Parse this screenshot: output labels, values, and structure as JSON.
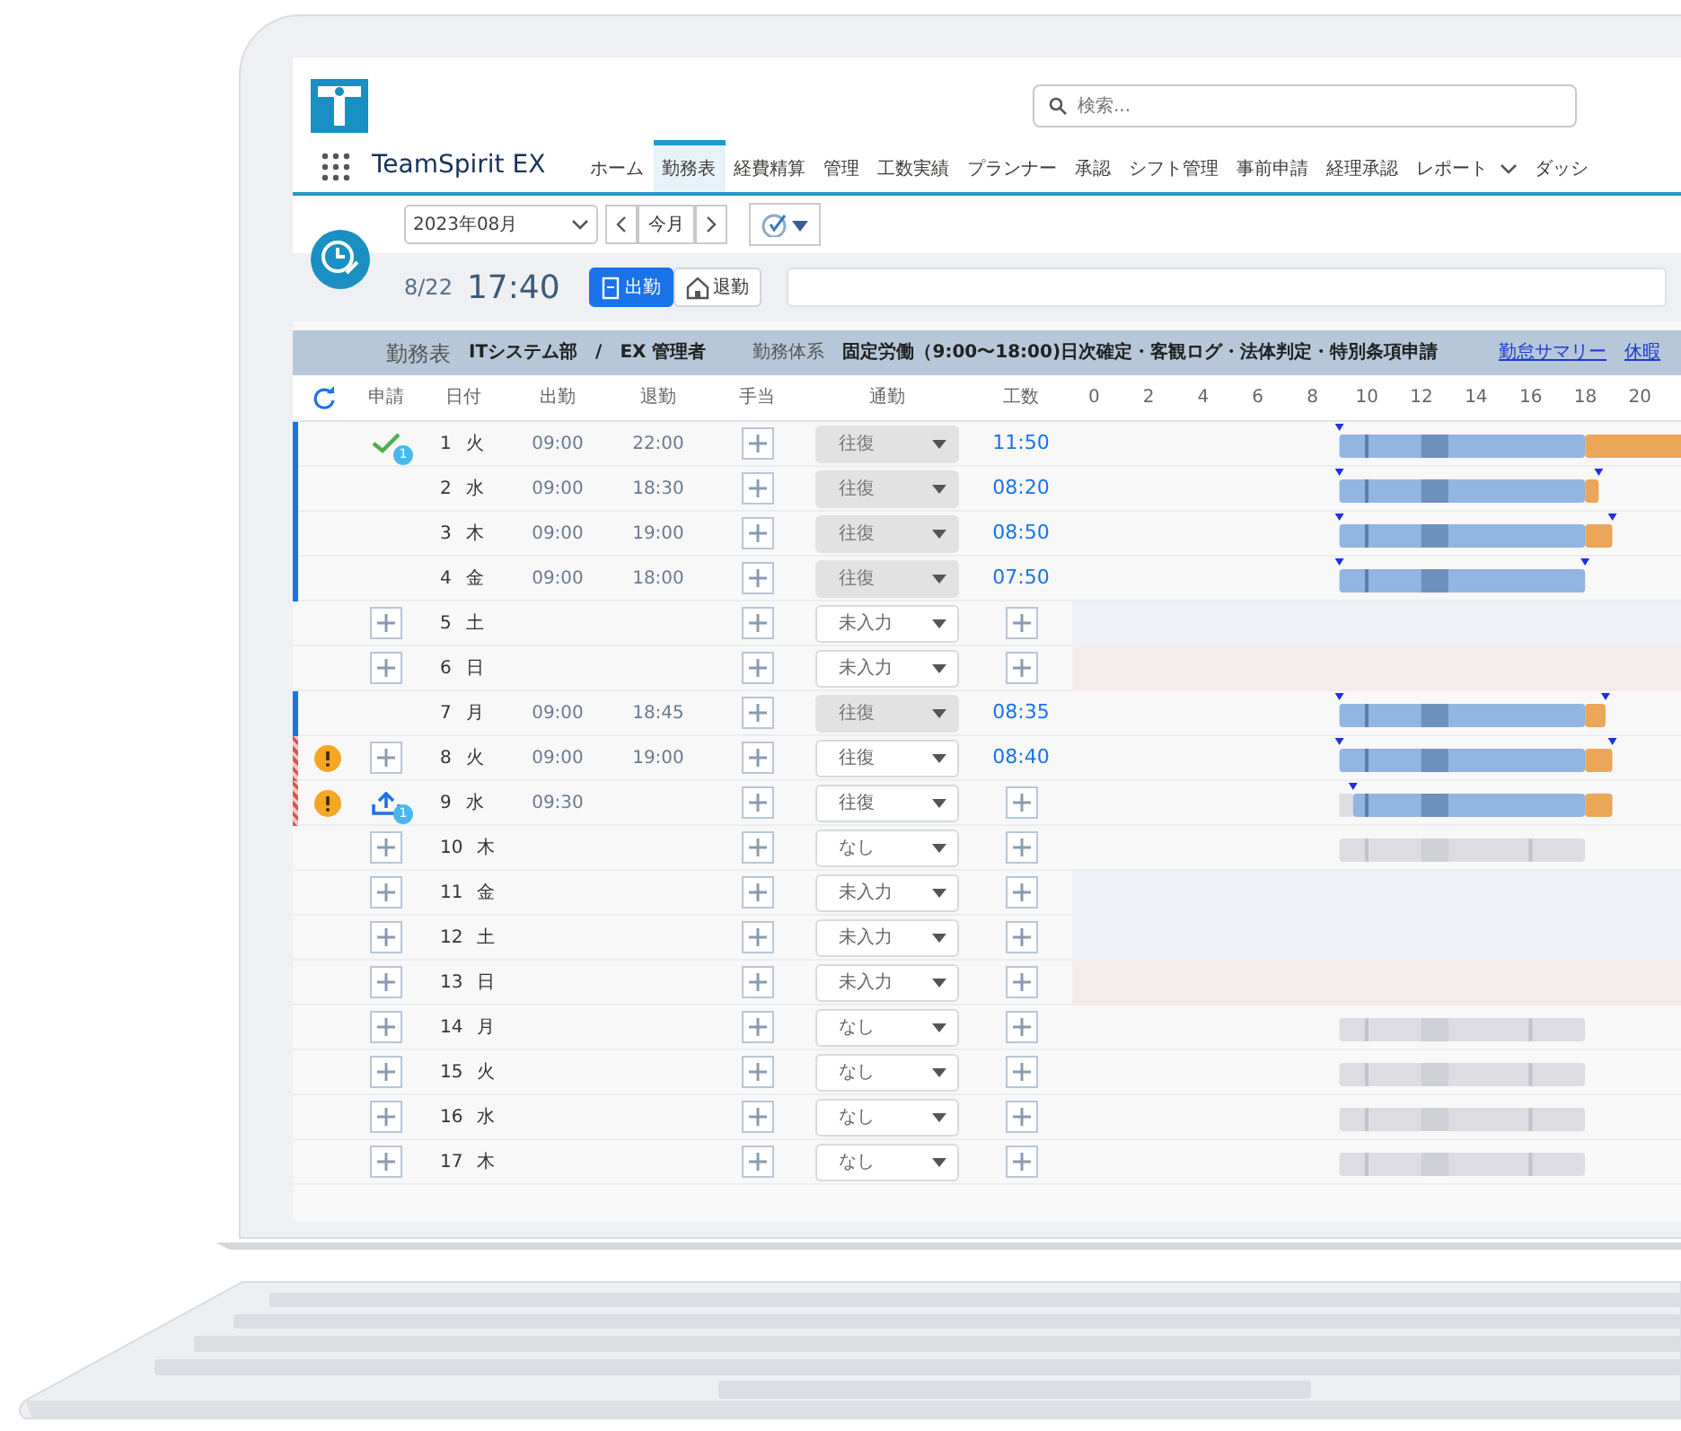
{
  "header": {
    "search": {
      "placeholder": "検索..."
    },
    "app_name": "TeamSpirit EX",
    "tabs": [
      {
        "label": "ホーム",
        "selected": false
      },
      {
        "label": "勤務表",
        "selected": true
      },
      {
        "label": "経費精算",
        "selected": false
      },
      {
        "label": "管理",
        "selected": false
      },
      {
        "label": "工数実績",
        "selected": false
      },
      {
        "label": "プランナー",
        "selected": false
      },
      {
        "label": "承認",
        "selected": false
      },
      {
        "label": "シフト管理",
        "selected": false
      },
      {
        "label": "事前申請",
        "selected": false
      },
      {
        "label": "経理承認",
        "selected": false
      },
      {
        "label": "レポート",
        "selected": false,
        "menu": true
      },
      {
        "label": "ダッシ",
        "selected": false,
        "menu": false
      }
    ]
  },
  "toolbar": {
    "month": "2023年08月",
    "today": "今月"
  },
  "clock": {
    "date": "8/22",
    "time": "17:40",
    "buttons": [
      {
        "label": "出勤",
        "kind": "in",
        "selected": true
      },
      {
        "label": "退勤",
        "kind": "out",
        "selected": false
      }
    ]
  },
  "band": {
    "title": "勤務表",
    "department": "ITシステム部",
    "separator": "/",
    "user": "EX 管理者",
    "system_label": "勤務体系",
    "system": "固定労働（9:00〜18:00)日次確定・客観ログ・法体判定・特別条項申請",
    "links": [
      "勤怠サマリー",
      "休暇"
    ]
  },
  "table": {
    "columns": [
      "申請",
      "日付",
      "出勤",
      "退勤",
      "手当",
      "通勤",
      "工数"
    ],
    "hours": [
      "0",
      "2",
      "4",
      "6",
      "8",
      "10",
      "12",
      "14",
      "16",
      "18",
      "20"
    ],
    "rows": [
      {
        "kind": "workday",
        "day": "1",
        "weekday": "火",
        "in": "09:00",
        "out": "22:00",
        "commute": {
          "value": "往復",
          "locked": true
        },
        "hours": "11:50",
        "apply": {
          "kind": "approved",
          "badge": "1"
        },
        "confirmed": true,
        "error": false,
        "alert": false,
        "timeline": {
          "kind": "actual"
        }
      },
      {
        "kind": "workday",
        "day": "2",
        "weekday": "水",
        "in": "09:00",
        "out": "18:30",
        "commute": {
          "value": "往復",
          "locked": true
        },
        "hours": "08:20",
        "apply": {
          "kind": "none"
        },
        "confirmed": true,
        "error": false,
        "alert": false,
        "timeline": {
          "kind": "actual"
        }
      },
      {
        "kind": "workday",
        "day": "3",
        "weekday": "木",
        "in": "09:00",
        "out": "19:00",
        "commute": {
          "value": "往復",
          "locked": true
        },
        "hours": "08:50",
        "apply": {
          "kind": "none"
        },
        "confirmed": true,
        "error": false,
        "alert": false,
        "timeline": {
          "kind": "actual"
        }
      },
      {
        "kind": "workday",
        "day": "4",
        "weekday": "金",
        "in": "09:00",
        "out": "18:00",
        "commute": {
          "value": "往復",
          "locked": true
        },
        "hours": "07:50",
        "apply": {
          "kind": "none"
        },
        "confirmed": true,
        "error": false,
        "alert": false,
        "timeline": {
          "kind": "actual"
        }
      },
      {
        "kind": "holiday",
        "day": "5",
        "weekday": "土",
        "commute": {
          "value": "未入力",
          "locked": false
        },
        "apply": {
          "kind": "add"
        },
        "confirmed": false,
        "error": false,
        "alert": false,
        "timeline": {
          "kind": "none"
        }
      },
      {
        "kind": "legal_holiday",
        "day": "6",
        "weekday": "日",
        "commute": {
          "value": "未入力",
          "locked": false
        },
        "apply": {
          "kind": "add"
        },
        "confirmed": false,
        "error": false,
        "alert": false,
        "timeline": {
          "kind": "none"
        }
      },
      {
        "kind": "workday",
        "day": "7",
        "weekday": "月",
        "in": "09:00",
        "out": "18:45",
        "commute": {
          "value": "往復",
          "locked": true
        },
        "hours": "08:35",
        "apply": {
          "kind": "none"
        },
        "confirmed": true,
        "error": false,
        "alert": false,
        "timeline": {
          "kind": "actual"
        }
      },
      {
        "kind": "workday",
        "day": "8",
        "weekday": "火",
        "in": "09:00",
        "out": "19:00",
        "commute": {
          "value": "往復",
          "locked": false
        },
        "hours": "08:40",
        "apply": {
          "kind": "add"
        },
        "confirmed": false,
        "error": true,
        "alert": true,
        "timeline": {
          "kind": "actual"
        }
      },
      {
        "kind": "workday",
        "day": "9",
        "weekday": "水",
        "in": "09:30",
        "commute": {
          "value": "往復",
          "locked": false
        },
        "apply": {
          "kind": "submitted",
          "badge": "1"
        },
        "confirmed": false,
        "error": true,
        "alert": true,
        "timeline": {
          "kind": "actual"
        }
      },
      {
        "kind": "workday",
        "day": "10",
        "weekday": "木",
        "commute": {
          "value": "なし",
          "locked": false
        },
        "apply": {
          "kind": "add"
        },
        "confirmed": false,
        "error": false,
        "alert": false,
        "timeline": {
          "kind": "planned"
        }
      },
      {
        "kind": "holiday",
        "day": "11",
        "weekday": "金",
        "commute": {
          "value": "未入力",
          "locked": false
        },
        "apply": {
          "kind": "add"
        },
        "confirmed": false,
        "error": false,
        "alert": false,
        "timeline": {
          "kind": "none"
        }
      },
      {
        "kind": "holiday",
        "day": "12",
        "weekday": "土",
        "commute": {
          "value": "未入力",
          "locked": false
        },
        "apply": {
          "kind": "add"
        },
        "confirmed": false,
        "error": false,
        "alert": false,
        "timeline": {
          "kind": "none"
        }
      },
      {
        "kind": "legal_holiday",
        "day": "13",
        "weekday": "日",
        "commute": {
          "value": "未入力",
          "locked": false
        },
        "apply": {
          "kind": "add"
        },
        "confirmed": false,
        "error": false,
        "alert": false,
        "timeline": {
          "kind": "none"
        }
      },
      {
        "kind": "workday",
        "day": "14",
        "weekday": "月",
        "commute": {
          "value": "なし",
          "locked": false
        },
        "apply": {
          "kind": "add"
        },
        "confirmed": false,
        "error": false,
        "alert": false,
        "timeline": {
          "kind": "planned"
        }
      },
      {
        "kind": "workday",
        "day": "15",
        "weekday": "火",
        "commute": {
          "value": "なし",
          "locked": false
        },
        "apply": {
          "kind": "add"
        },
        "confirmed": false,
        "error": false,
        "alert": false,
        "timeline": {
          "kind": "planned"
        }
      },
      {
        "kind": "workday",
        "day": "16",
        "weekday": "水",
        "commute": {
          "value": "なし",
          "locked": false
        },
        "apply": {
          "kind": "add"
        },
        "confirmed": false,
        "error": false,
        "alert": false,
        "timeline": {
          "kind": "planned"
        }
      },
      {
        "kind": "workday",
        "day": "17",
        "weekday": "木",
        "commute": {
          "value": "なし",
          "locked": false
        },
        "apply": {
          "kind": "add"
        },
        "confirmed": false,
        "error": false,
        "alert": false,
        "timeline": {
          "kind": "planned"
        }
      }
    ]
  }
}
